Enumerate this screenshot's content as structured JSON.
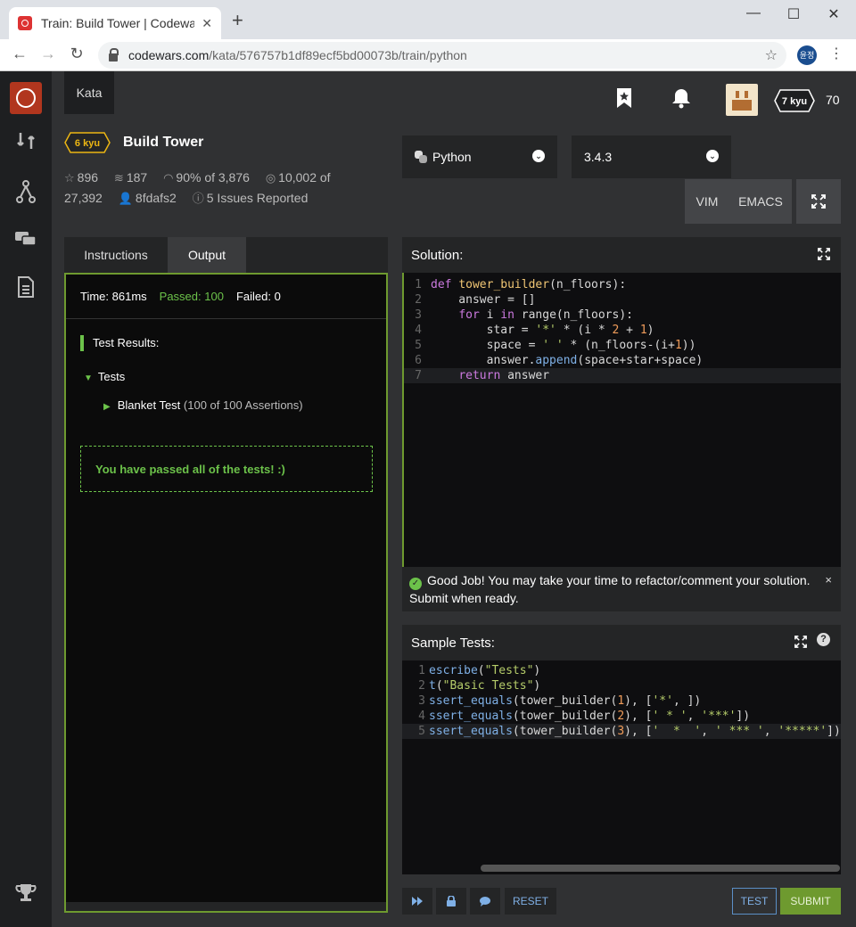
{
  "browser": {
    "tab_title": "Train: Build Tower | Codewa",
    "tab_close": "✕",
    "new_tab": "+",
    "url_domain": "codewars.com",
    "url_path": "/kata/576757b1df89ecf5bd00073b/train/python",
    "profile_initials": "윤정"
  },
  "nav": {
    "kata_tab": "Kata",
    "rank": "7 kyu",
    "honor": "70"
  },
  "kata": {
    "rank": "6 kyu",
    "title": "Build Tower",
    "stars": "896",
    "collections": "187",
    "satisfaction": "90% of 3,876",
    "completed": "10,002 of",
    "completed_total": "27,392",
    "author": "8fdafs2",
    "issues": "5 Issues Reported"
  },
  "selectors": {
    "language": "Python",
    "version": "3.4.3",
    "vim": "VIM",
    "emacs": "EMACS"
  },
  "left_panel": {
    "tabs": [
      "Instructions",
      "Output"
    ],
    "time": "Time: 861ms",
    "passed": "Passed: 100",
    "failed": "Failed: 0",
    "results_title": "Test Results:",
    "tests_label": "Tests",
    "blanket_test": "Blanket Test",
    "assertions": "(100 of 100 Assertions)",
    "pass_message": "You have passed all of the tests! :)"
  },
  "solution": {
    "title": "Solution:",
    "lines": [
      "1",
      "2",
      "3",
      "4",
      "5",
      "6",
      "7"
    ]
  },
  "notice": {
    "message": "Good Job! You may take your time to refactor/comment your solution. Submit when ready.",
    "close": "×"
  },
  "sample_tests": {
    "title": "Sample Tests:",
    "help": "?",
    "lines": [
      "1",
      "2",
      "3",
      "4",
      "5"
    ]
  },
  "buttons": {
    "reset": "RESET",
    "test": "TEST",
    "submit": "SUBMIT"
  },
  "colors": {
    "accent_green": "#6e9a2f",
    "pass_green": "#6cc24a",
    "kyu_yellow": "#ecb613",
    "brand_red": "#b1361e"
  },
  "icons": [
    "codewars-logo",
    "practice-icon",
    "fork-icon",
    "discuss-icon",
    "docs-icon",
    "trophy-icon",
    "bookmark-icon",
    "bell-icon",
    "expand-icon",
    "check-icon",
    "lock-icon",
    "chat-icon",
    "fast-forward-icon"
  ]
}
